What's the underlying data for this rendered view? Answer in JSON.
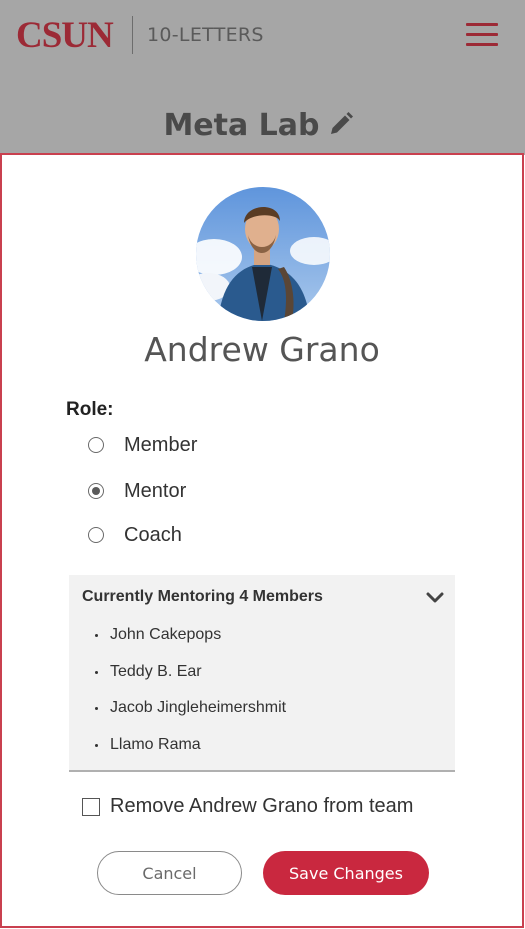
{
  "header": {
    "logo_text": "CSUN",
    "app_name": "10-LETTERS",
    "team_title": "Meta Lab",
    "menu_icon": "hamburger-menu-icon",
    "edit_icon": "pencil-icon"
  },
  "modal": {
    "member_name": "Andrew Grano",
    "role_label": "Role:",
    "roles": [
      {
        "label": "Member",
        "selected": false
      },
      {
        "label": "Mentor",
        "selected": true
      },
      {
        "label": "Coach",
        "selected": false
      }
    ],
    "mentoring": {
      "heading": "Currently Mentoring 4 Members",
      "expand_icon": "chevron-down-icon",
      "members": [
        "John Cakepops",
        "Teddy B. Ear",
        "Jacob Jingleheimershmit",
        "Llamo Rama"
      ]
    },
    "remove_label": "Remove Andrew Grano from team",
    "remove_checked": false,
    "cancel_label": "Cancel",
    "save_label": "Save Changes"
  },
  "colors": {
    "brand_red": "#9c2a36",
    "accent_red": "#c9283f",
    "overlay_gray": "#a6a6a6"
  }
}
